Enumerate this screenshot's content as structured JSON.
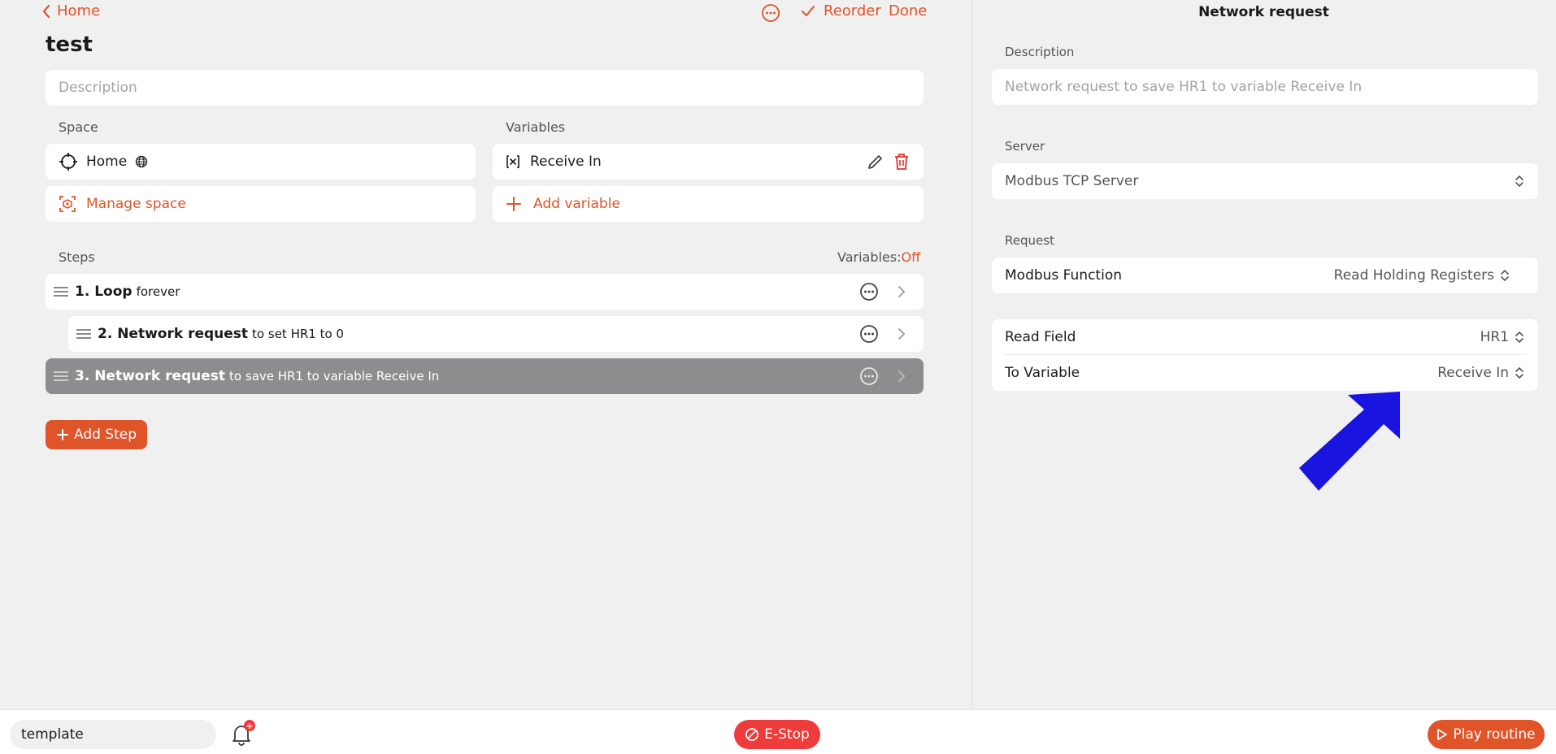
{
  "header": {
    "back_label": "Home",
    "reorder_label": "Reorder",
    "done_label": "Done"
  },
  "routine": {
    "title": "test",
    "description_placeholder": "Description"
  },
  "space": {
    "label": "Space",
    "value": "Home",
    "manage_label": "Manage space"
  },
  "variables": {
    "label": "Variables",
    "items": [
      "Receive In"
    ],
    "add_label": "Add variable"
  },
  "steps": {
    "label": "Steps",
    "variables_toggle_label": "Variables:",
    "variables_toggle_value": "Off",
    "items": [
      {
        "name": "1. Loop",
        "detail": "forever"
      },
      {
        "name": "2. Network request",
        "detail": "to set HR1 to 0"
      },
      {
        "name": "3. Network request",
        "detail": "to save HR1 to variable Receive In"
      }
    ],
    "add_label": "Add Step"
  },
  "panel": {
    "title": "Network request",
    "description_label": "Description",
    "description_placeholder": "Network request to save HR1 to variable Receive In",
    "server_label": "Server",
    "server_value": "Modbus TCP Server",
    "request_label": "Request",
    "function_label": "Modbus Function",
    "function_value": "Read Holding Registers",
    "read_field_label": "Read Field",
    "read_field_value": "HR1",
    "to_variable_label": "To Variable",
    "to_variable_value": "Receive In"
  },
  "footer": {
    "template_value": "template",
    "notification_count": "+",
    "estop_label": "E-Stop",
    "play_label": "Play routine"
  },
  "colors": {
    "accent": "#e0542a",
    "estop": "#ee3b3b",
    "arrow": "#1a14e0"
  }
}
